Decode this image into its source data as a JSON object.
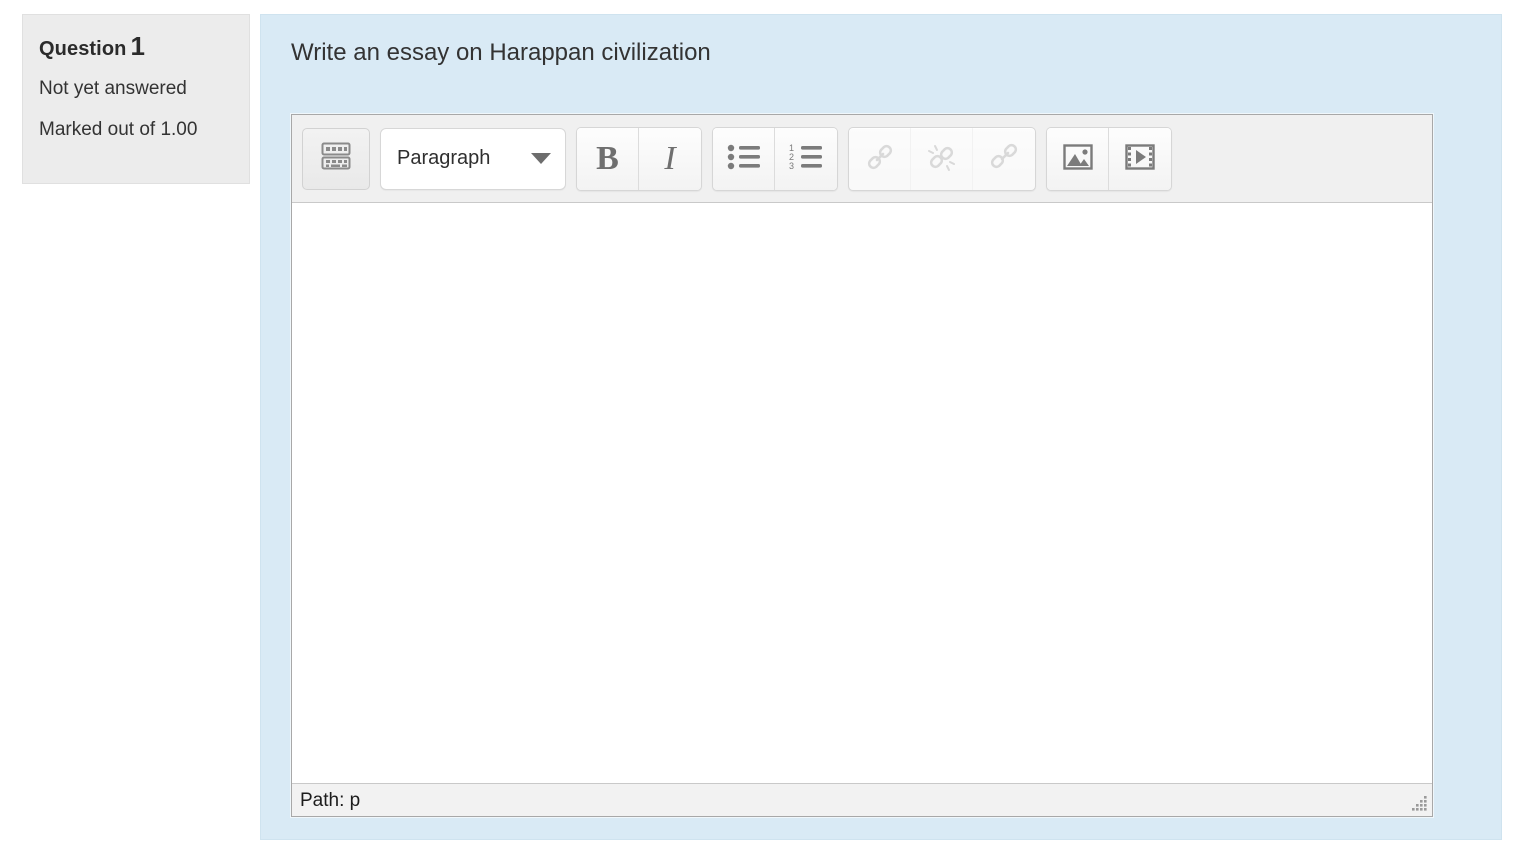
{
  "question_info": {
    "question_label": "Question",
    "question_number": "1",
    "state": "Not yet answered",
    "grade": "Marked out of 1.00"
  },
  "question": {
    "text": "Write an essay on Harappan civilization"
  },
  "editor": {
    "toolbar": {
      "toggle_toolbar": {
        "icon": "keyboard-icon",
        "label": ""
      },
      "format_select": {
        "value": "Paragraph",
        "caret_icon": "chevron-down-icon"
      },
      "buttons": [
        {
          "name": "bold",
          "glyph": "B",
          "icon": "bold-icon",
          "disabled": false
        },
        {
          "name": "italic",
          "glyph": "I",
          "icon": "italic-icon",
          "disabled": false
        },
        {
          "name": "bullet-list",
          "glyph": "",
          "icon": "bullet-list-icon",
          "disabled": false
        },
        {
          "name": "numbered-list",
          "glyph": "",
          "icon": "numbered-list-icon",
          "disabled": false
        },
        {
          "name": "link",
          "glyph": "",
          "icon": "link-icon",
          "disabled": true
        },
        {
          "name": "unlink",
          "glyph": "",
          "icon": "unlink-icon",
          "disabled": true
        },
        {
          "name": "auto-link",
          "glyph": "",
          "icon": "auto-link-icon",
          "disabled": true
        },
        {
          "name": "insert-image",
          "glyph": "",
          "icon": "image-icon",
          "disabled": false
        },
        {
          "name": "insert-media",
          "glyph": "",
          "icon": "media-icon",
          "disabled": false
        }
      ]
    },
    "content": "",
    "statusbar": {
      "path": "Path: p",
      "resize_grip_icon": "resize-grip-icon"
    }
  },
  "colors": {
    "panel_background": "#d9eaf5",
    "info_background": "#ececec",
    "toolbar_background": "#f0f0f0",
    "editor_background": "#ffffff",
    "text": "#333333",
    "icon": "#6f6f6f",
    "icon_disabled": "#cfcfcf"
  }
}
